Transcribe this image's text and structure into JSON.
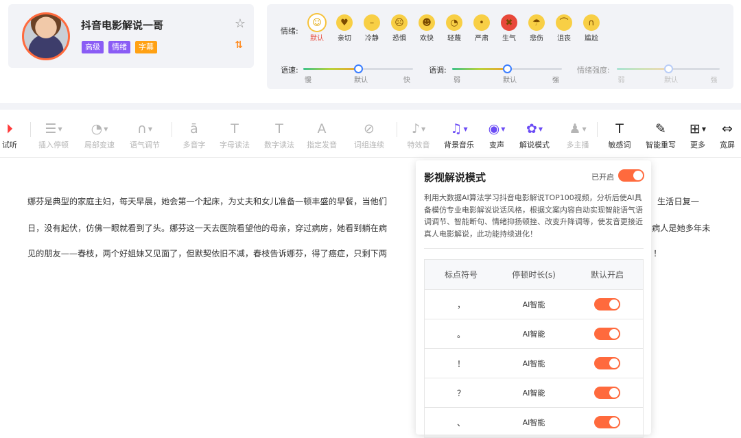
{
  "voice": {
    "name": "抖音电影解说一哥",
    "tags": [
      "高级",
      "情绪",
      "字幕"
    ]
  },
  "emotion": {
    "label": "情绪:",
    "items": [
      {
        "label": "默认",
        "face": "☺",
        "color": "#f8cf45",
        "selected": true
      },
      {
        "label": "亲切",
        "face": "♥",
        "color": "#f8cf45"
      },
      {
        "label": "冷静",
        "face": "–",
        "color": "#f8cf45"
      },
      {
        "label": "恐惧",
        "face": "☹",
        "color": "#f8cf45"
      },
      {
        "label": "欢快",
        "face": "☻",
        "color": "#f8cf45"
      },
      {
        "label": "轻蔑",
        "face": "◔",
        "color": "#f8cf45"
      },
      {
        "label": "严肃",
        "face": "•",
        "color": "#f8cf45"
      },
      {
        "label": "生气",
        "face": "✖",
        "color": "#e8483a"
      },
      {
        "label": "悲伤",
        "face": "☂",
        "color": "#f8cf45"
      },
      {
        "label": "沮丧",
        "face": "⌒",
        "color": "#f8cf45"
      },
      {
        "label": "尴尬",
        "face": "∩",
        "color": "#f8cf45"
      }
    ]
  },
  "sliders": [
    {
      "name": "语速:",
      "ticks": [
        "慢",
        "默认",
        "快"
      ],
      "value": 0.5,
      "enabled": true
    },
    {
      "name": "语调:",
      "ticks": [
        "弱",
        "默认",
        "强"
      ],
      "value": 0.5,
      "enabled": true
    },
    {
      "name": "情绪强度:",
      "ticks": [
        "弱",
        "默认",
        "强"
      ],
      "value": 0.5,
      "enabled": false
    }
  ],
  "toolbar": [
    {
      "label": "试听",
      "icon": "play-icon",
      "glyph": "⏵"
    },
    {
      "label": "插入停顿",
      "icon": "insert-pause-icon",
      "glyph": "☰",
      "caret": true
    },
    {
      "label": "局部变速",
      "icon": "speed-gauge-icon",
      "glyph": "◔",
      "caret": true
    },
    {
      "label": "语气调节",
      "icon": "tone-wave-icon",
      "glyph": "∩",
      "caret": true
    },
    {
      "label": "多音字",
      "icon": "polyphone-icon",
      "glyph": "ā"
    },
    {
      "label": "字母读法",
      "icon": "letter-reading-icon",
      "glyph": "T"
    },
    {
      "label": "数字读法",
      "icon": "number-reading-icon",
      "glyph": "T"
    },
    {
      "label": "指定发音",
      "icon": "pronunciation-icon",
      "glyph": "A"
    },
    {
      "label": "词组连续",
      "icon": "phrase-link-icon",
      "glyph": "⊘"
    },
    {
      "label": "特效音",
      "icon": "sound-effect-icon",
      "glyph": "♪",
      "caret": true
    },
    {
      "label": "背景音乐",
      "icon": "background-music-icon",
      "glyph": "♫",
      "caret": true
    },
    {
      "label": "变声",
      "icon": "voice-change-icon",
      "glyph": "◉",
      "caret": true
    },
    {
      "label": "解说模式",
      "icon": "narration-mode-icon",
      "glyph": "✿",
      "caret": true
    },
    {
      "label": "多主播",
      "icon": "multi-anchor-icon",
      "glyph": "♟",
      "caret": true
    },
    {
      "label": "敏感词",
      "icon": "sensitive-word-icon",
      "glyph": "T"
    },
    {
      "label": "智能重写",
      "icon": "smart-rewrite-icon",
      "glyph": "✎"
    },
    {
      "label": "更多",
      "icon": "more-grid-icon",
      "glyph": "⊞",
      "caret": true
    },
    {
      "label": "宽屏",
      "icon": "widescreen-icon",
      "glyph": "⇔"
    }
  ],
  "text": {
    "line1": "娜芬是典型的家庭主妇，每天早晨，她会第一个起床，为丈夫和女儿准备一顿丰盛的早餐，当他们",
    "line1_end": "生活日复一",
    "line2": "日，没有起伏，仿佛一眼就看到了头。娜芬这一天去医院看望他的母亲，穿过病房，她看到躺在病",
    "line2_end": "病人是她多年未",
    "line3": "见的朋友——春枝，两个好姐妹又见面了，但默契依旧不减，春枝告诉娜芬，得了癌症，只剩下两",
    "line3_end": "！"
  },
  "popup": {
    "title": "影视解说模式",
    "state": "已开启",
    "enabled": true,
    "description": "利用大数据AI算法学习抖音电影解说TOP100视频，分析后使AI具备模仿专业电影解说说话风格，根据文案内容自动实现智能语气语调调节、智能断句、情绪抑扬顿挫、改变升降调等，使发音更接近真人电影解说，此功能持续进化！",
    "columns": [
      "标点符号",
      "停顿时长(s)",
      "默认开启"
    ],
    "rows": [
      {
        "symbol": "，",
        "duration": "AI智能",
        "on": true
      },
      {
        "symbol": "。",
        "duration": "AI智能",
        "on": true
      },
      {
        "symbol": "！",
        "duration": "AI智能",
        "on": true
      },
      {
        "symbol": "？",
        "duration": "AI智能",
        "on": true
      },
      {
        "symbol": "、",
        "duration": "AI智能",
        "on": true
      }
    ]
  }
}
